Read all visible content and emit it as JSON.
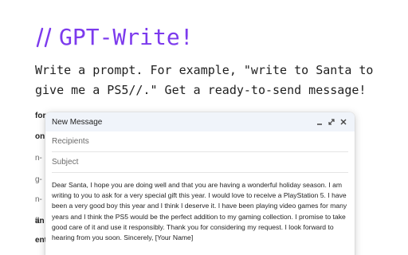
{
  "brand": {
    "title": "GPT-Write!",
    "icon": "double-slash-icon",
    "accent_color": "#7c3aed"
  },
  "tagline": "Write a prompt. For example, \"write to Santa to give me a PS5//.\" Get a ready-to-send message!",
  "background_fragments": [
    "for",
    "on",
    "n-",
    "g-",
    "n-",
    "g-",
    "an",
    "ent"
  ],
  "compose": {
    "title": "New Message",
    "recipients_placeholder": "Recipients",
    "subject_placeholder": "Subject",
    "body": "Dear Santa, I hope you are doing well and that you are having a wonderful holiday season. I am writing to you to ask for a very special gift this year. I would love to receive a PlayStation 5. I have been a very good boy this year and I think I deserve it. I have been playing video games for many years and I think the PS5 would be the perfect addition to my gaming collection. I promise to take good care of it and use it responsibly. Thank you for considering my request. I look forward to hearing from you soon. Sincerely, [Your Name]",
    "header_icons": [
      "minimize-icon",
      "pop-out-icon",
      "close-icon"
    ]
  }
}
